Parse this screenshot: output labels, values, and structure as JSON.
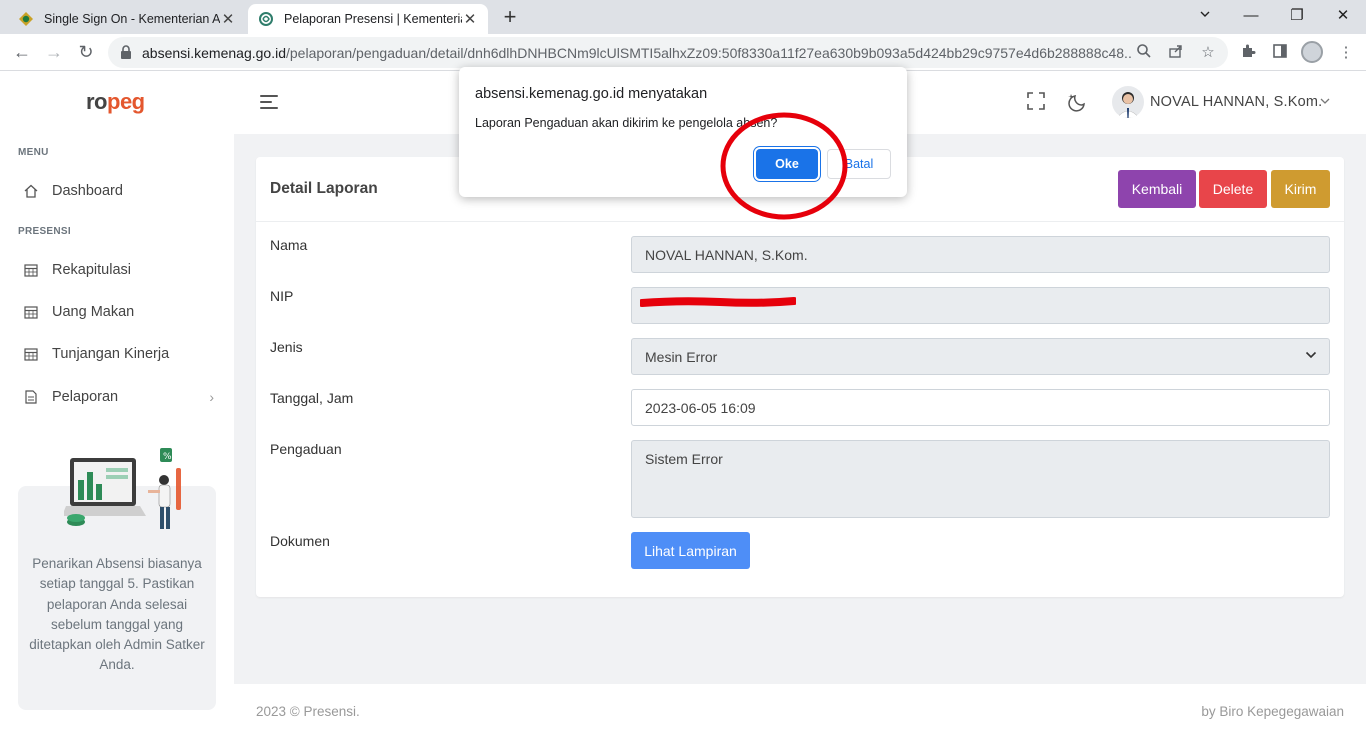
{
  "browser": {
    "tabs": [
      {
        "title": "Single Sign On - Kementerian Agama",
        "active": false
      },
      {
        "title": "Pelaporan Presensi | Kementerian Agama",
        "active": true
      }
    ],
    "url_host": "absensi.kemenag.go.id",
    "url_path": "/pelaporan/pengaduan/detail/dnh6dlhDNHBCNm9lcUlSMTI5alhxZz09:50f8330a11f27ea630b9b093a5d424bb29c9757e4d6b288888c48..."
  },
  "app": {
    "logo": {
      "part1": "ro",
      "part2": "peg"
    },
    "sidebar": {
      "section_menu": "MENU",
      "section_presensi": "PRESENSI",
      "items": [
        {
          "label": "Dashboard",
          "icon": "home-icon"
        },
        {
          "label": "Rekapitulasi",
          "icon": "calendar-icon"
        },
        {
          "label": "Uang Makan",
          "icon": "calendar-icon"
        },
        {
          "label": "Tunjangan Kinerja",
          "icon": "calendar-icon"
        },
        {
          "label": "Pelaporan",
          "icon": "document-icon"
        }
      ],
      "promo_text": "Penarikan Absensi biasanya setiap tanggal 5. Pastikan pelaporan Anda selesai sebelum tanggal yang ditetapkan oleh Admin Satker Anda."
    },
    "header": {
      "user_name": "NOVAL HANNAN, S.Kom."
    },
    "card": {
      "title": "Detail Laporan",
      "buttons": {
        "back": "Kembali",
        "delete": "Delete",
        "send": "Kirim"
      },
      "fields": {
        "nama_label": "Nama",
        "nama_value": "NOVAL HANNAN, S.Kom.",
        "nip_label": "NIP",
        "nip_value": "",
        "jenis_label": "Jenis",
        "jenis_value": "Mesin Error",
        "tanggal_label": "Tanggal, Jam",
        "tanggal_value": "2023-06-05 16:09",
        "pengaduan_label": "Pengaduan",
        "pengaduan_value": "Sistem Error",
        "dokumen_label": "Dokumen",
        "lampiran_button": "Lihat Lampiran"
      }
    },
    "footer": {
      "left": "2023 © Presensi.",
      "right": "by Biro Kepegegawaian"
    }
  },
  "dialog": {
    "title": "absensi.kemenag.go.id menyatakan",
    "message": "Laporan Pengaduan akan dikirim ke pengelola absen?",
    "ok_label": "Oke",
    "cancel_label": "Batal"
  },
  "colors": {
    "btn_back": "#8e44ad",
    "btn_delete": "#e8454a",
    "btn_send": "#cf9b30",
    "btn_lampiran": "#4e8ef7",
    "dialog_ok": "#1a73e8",
    "annotation": "#e6000b"
  }
}
